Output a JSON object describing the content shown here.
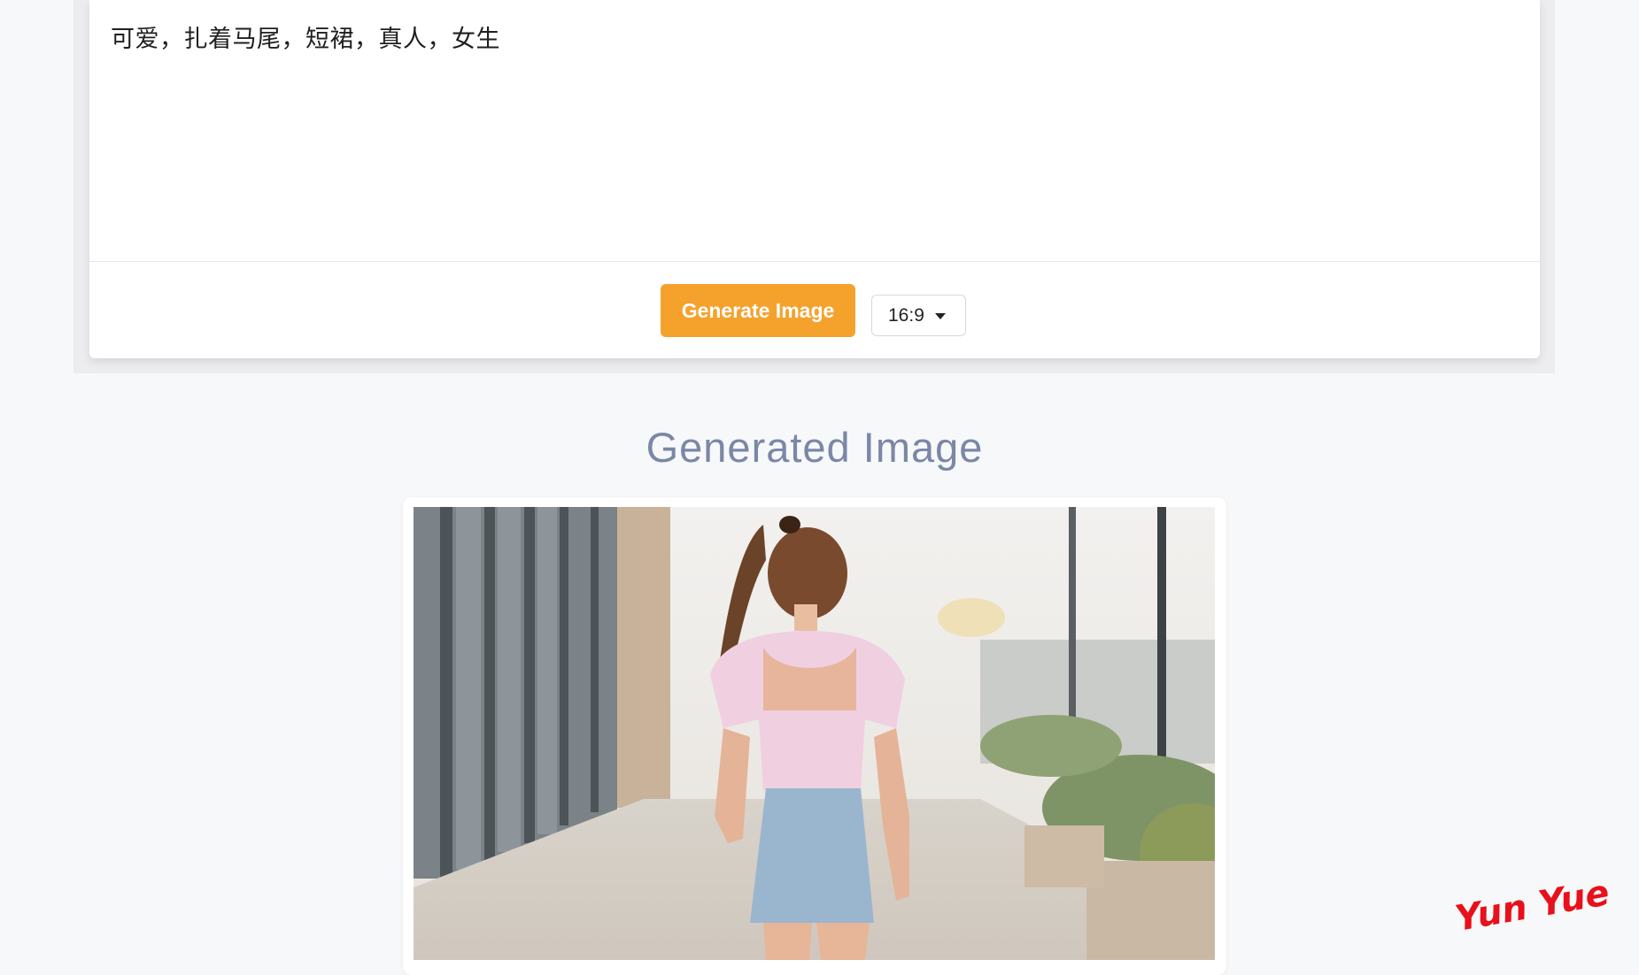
{
  "prompt": {
    "value": "可爱，扎着马尾，短裙，真人，女生"
  },
  "controls": {
    "generate_label": "Generate Image",
    "aspect_ratio": "16:9"
  },
  "result": {
    "heading": "Generated Image"
  },
  "watermark": "Yun Yue",
  "colors": {
    "accent": "#f5a22d",
    "heading": "#7b87a6",
    "watermark": "#e8101a"
  }
}
